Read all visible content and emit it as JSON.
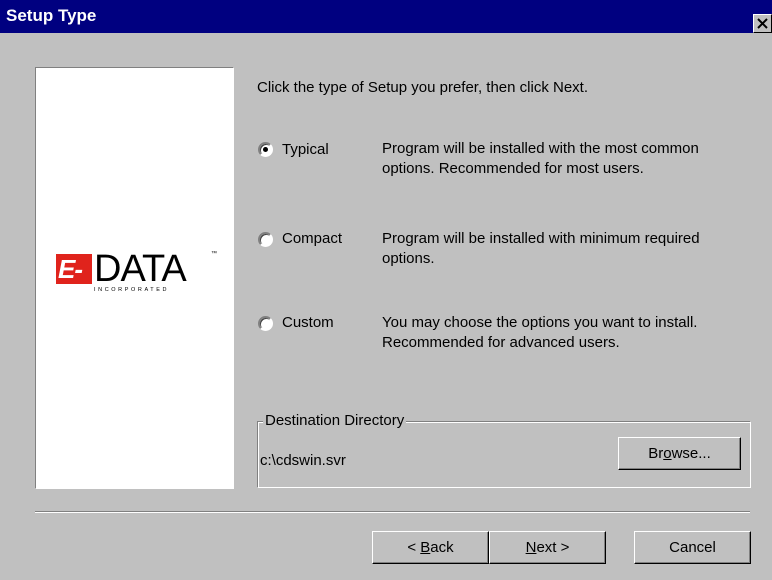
{
  "window": {
    "title": "Setup Type"
  },
  "logo": {
    "mark": "E-Z",
    "word": "DATA",
    "tm": "™",
    "subtitle": "INCORPORATED"
  },
  "instruction": "Click the type of Setup you prefer, then click Next.",
  "options": [
    {
      "label": "Typical",
      "desc1": "Program will be installed with the most common",
      "desc2": "options. Recommended for most users.",
      "selected": true
    },
    {
      "label": "Compact",
      "desc1": "Program will be installed with minimum required",
      "desc2": "options.",
      "selected": false
    },
    {
      "label": "Custom",
      "desc1": "You may choose the options you want to install.",
      "desc2": "Recommended for advanced users.",
      "selected": false
    }
  ],
  "destination": {
    "legend": "Destination Directory",
    "path": "c:\\cdswin.svr",
    "browse_pre": "Br",
    "browse_u": "o",
    "browse_post": "wse..."
  },
  "buttons": {
    "back_pre": "< ",
    "back_u": "B",
    "back_post": "ack",
    "next_u": "N",
    "next_post": "ext >",
    "cancel": "Cancel"
  }
}
